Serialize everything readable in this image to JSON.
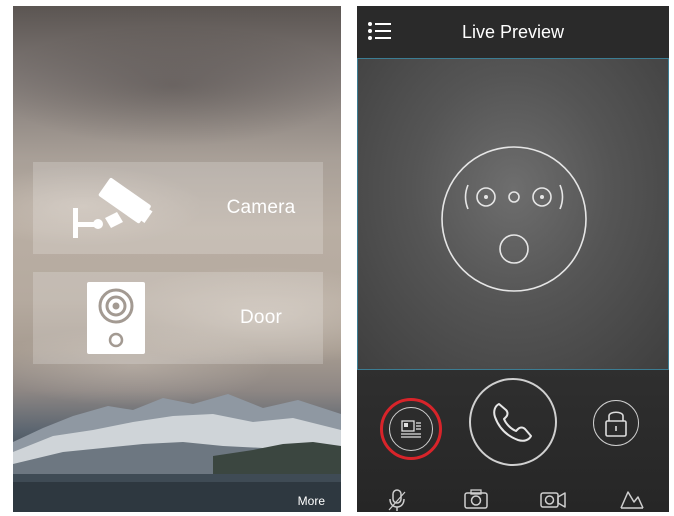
{
  "left_screen": {
    "tiles": [
      {
        "label": "Camera",
        "icon": "cctv-camera-icon"
      },
      {
        "label": "Door",
        "icon": "door-station-icon"
      }
    ],
    "more_label": "More"
  },
  "right_screen": {
    "title": "Live Preview",
    "menu_icon": "menu-icon",
    "controls": {
      "snapshot_icon": "snapshot-icon",
      "call_icon": "phone-icon",
      "unlock_icon": "lock-icon",
      "highlight_color": "#d8242a"
    },
    "bottom_bar_icons": [
      "microphone-icon",
      "camera-icon",
      "video-record-icon",
      "chart-icon"
    ],
    "accent_border_color": "#3c7d93"
  }
}
